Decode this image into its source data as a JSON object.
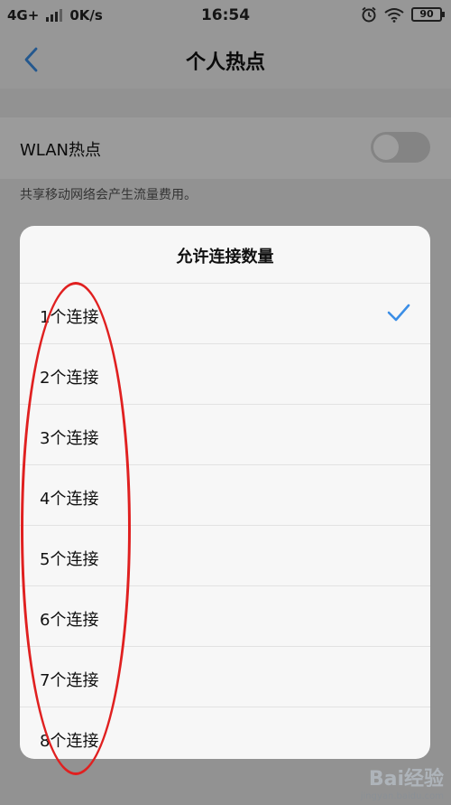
{
  "status_bar": {
    "network": "4G+",
    "speed": "0K/s",
    "time": "16:54",
    "battery": "90",
    "icons": [
      "signal-icon",
      "alarm-icon",
      "wifi-icon",
      "battery-icon"
    ]
  },
  "header": {
    "title": "个人热点",
    "back_icon": "chevron-left-icon"
  },
  "settings": {
    "wlan_label": "WLAN热点",
    "wlan_toggle_on": false,
    "hint": "共享移动网络会产生流量费用。"
  },
  "dialog": {
    "title": "允许连接数量",
    "options": [
      {
        "label": "1个连接",
        "selected": true
      },
      {
        "label": "2个连接",
        "selected": false
      },
      {
        "label": "3个连接",
        "selected": false
      },
      {
        "label": "4个连接",
        "selected": false
      },
      {
        "label": "5个连接",
        "selected": false
      },
      {
        "label": "6个连接",
        "selected": false
      },
      {
        "label": "7个连接",
        "selected": false
      },
      {
        "label": "8个连接",
        "selected": false
      }
    ],
    "check_icon": "checkmark-icon"
  },
  "watermark": {
    "logo": "Bai经验",
    "url": "jingyan.baidu.com"
  },
  "colors": {
    "accent": "#3b8ee6",
    "annotation": "#e02020"
  }
}
